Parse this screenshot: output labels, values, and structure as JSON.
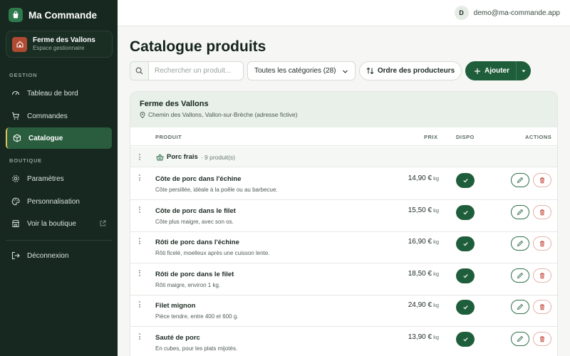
{
  "brand": {
    "name": "Ma Commande"
  },
  "shop": {
    "name": "Ferme des Vallons",
    "subtitle": "Espace gestionnaire"
  },
  "sidebar": {
    "sections": {
      "gestion": "GESTION",
      "boutique": "BOUTIQUE"
    },
    "items": [
      {
        "label": "Tableau de bord",
        "icon": "dashboard-icon"
      },
      {
        "label": "Commandes",
        "icon": "cart-icon"
      },
      {
        "label": "Catalogue",
        "icon": "box-icon",
        "active": true
      },
      {
        "label": "Paramètres",
        "icon": "gear-icon"
      },
      {
        "label": "Personnalisation",
        "icon": "palette-icon"
      },
      {
        "label": "Voir la boutique",
        "icon": "store-icon"
      },
      {
        "label": "Déconnexion",
        "icon": "logout-icon"
      }
    ]
  },
  "topbar": {
    "avatar_initial": "D",
    "email": "demo@ma-commande.app"
  },
  "page": {
    "title": "Catalogue produits"
  },
  "toolbar": {
    "search_placeholder": "Rechercher un produit...",
    "category_select": "Toutes les catégories (28)",
    "order_label": "Ordre des producteurs",
    "add_label": "Ajouter"
  },
  "producer": {
    "name": "Ferme des Vallons",
    "address": "Chemin des Vallons, Vallon-sur-Brèche (adresse fictive)"
  },
  "table": {
    "headers": {
      "product": "PRODUIT",
      "price": "PRIX",
      "dispo": "DISPO",
      "actions": "ACTIONS"
    },
    "group": {
      "name": "Porc frais",
      "count": "· 9 produit(s)"
    },
    "rows": [
      {
        "name": "Côte de porc dans l'échine",
        "desc": "Côte persillée, idéale à la poêle ou au barbecue.",
        "price": "14,90 €",
        "unit": "kg",
        "available": true
      },
      {
        "name": "Côte de porc dans le filet",
        "desc": "Côte plus maigre, avec son os.",
        "price": "15,50 €",
        "unit": "kg",
        "available": true
      },
      {
        "name": "Rôti de porc dans l'échine",
        "desc": "Rôti ficelé, moelleux après une cuisson lente.",
        "price": "16,90 €",
        "unit": "kg",
        "available": true
      },
      {
        "name": "Rôti de porc dans le filet",
        "desc": "Rôti maigre, environ 1 kg.",
        "price": "18,50 €",
        "unit": "kg",
        "available": true
      },
      {
        "name": "Filet mignon",
        "desc": "Pièce tendre, entre 400 et 600 g.",
        "price": "24,90 €",
        "unit": "kg",
        "available": true
      },
      {
        "name": "Sauté de porc",
        "desc": "En cubes, pour les plats mijotés.",
        "price": "13,90 €",
        "unit": "kg",
        "available": true
      }
    ]
  },
  "colors": {
    "sidebar_bg": "#16281f",
    "accent": "#1f5e3b",
    "active_marker": "#e2c25a",
    "danger": "#c0392b"
  }
}
